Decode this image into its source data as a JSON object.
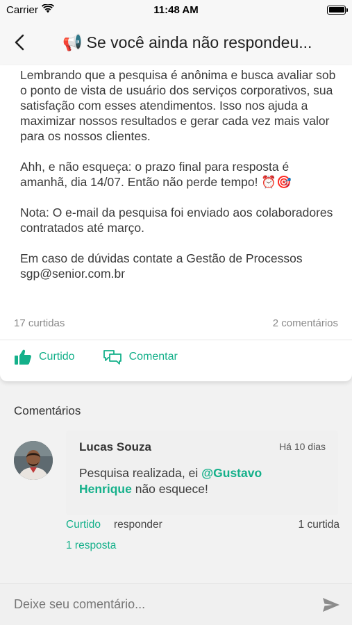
{
  "status_bar": {
    "carrier": "Carrier",
    "time": "11:48 AM"
  },
  "nav": {
    "title_emoji": "📢",
    "title": "Se você ainda não respondeu..."
  },
  "post": {
    "paragraphs": [
      "Lembrando que a pesquisa é anônima e busca avaliar sob o ponto de vista de usuário dos serviços corporativos, sua satisfação com esses atendimentos. Isso nos ajuda a maximizar nossos resultados e gerar cada vez mais valor para os nossos clientes.",
      "Ahh, e não esqueça: o prazo final para resposta é amanhã, dia 14/07. Então não perde tempo! ⏰🎯",
      "Nota: O e-mail da pesquisa foi enviado aos colaboradores contratados até março.",
      "Em caso de dúvidas contate a Gestão de Processos sgp@senior.com.br"
    ],
    "likes_count": "17 curtidas",
    "comments_count": "2 comentários",
    "like_label": "Curtido",
    "comment_label": "Comentar"
  },
  "comments": {
    "section_title": "Comentários",
    "items": [
      {
        "author": "Lucas Souza",
        "time": "Há 10 dias",
        "text_before": "Pesquisa realizada, ei ",
        "mention": "@Gustavo Henrique",
        "text_after": " não esquece!",
        "like_label": "Curtido",
        "reply_label": "responder",
        "likes": "1 curtida",
        "replies": "1 resposta"
      }
    ]
  },
  "input": {
    "placeholder": "Deixe seu comentário...",
    "value": ""
  },
  "colors": {
    "accent": "#14b08a",
    "background": "#f2f2f2",
    "card": "#ffffff"
  },
  "icons": [
    "wifi-icon",
    "battery-icon",
    "back-chevron-icon",
    "thumbs-up-icon",
    "chat-bubbles-icon",
    "send-icon"
  ]
}
